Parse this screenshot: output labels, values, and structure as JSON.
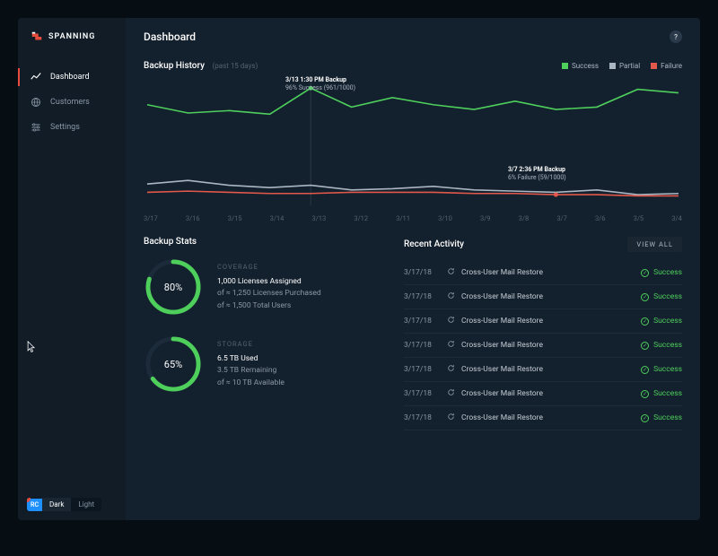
{
  "brand": {
    "name": "SPANNING"
  },
  "page_title": "Dashboard",
  "sidebar": {
    "items": [
      {
        "label": "Dashboard",
        "icon": "chart-line-icon",
        "active": true
      },
      {
        "label": "Customers",
        "icon": "globe-icon",
        "active": false
      },
      {
        "label": "Settings",
        "icon": "sliders-icon",
        "active": false
      }
    ]
  },
  "theme": {
    "badge": "RC",
    "badge_count": "1",
    "options": [
      {
        "label": "Dark",
        "active": true
      },
      {
        "label": "Light",
        "active": false
      }
    ]
  },
  "history": {
    "title": "Backup History",
    "subtitle": "(past 15 days)",
    "legend": [
      {
        "label": "Success",
        "color": "#4ecf5c"
      },
      {
        "label": "Partial",
        "color": "#aab6c2"
      },
      {
        "label": "Failure",
        "color": "#e2584a"
      }
    ],
    "x_labels": [
      "3/17",
      "3/16",
      "3/15",
      "3/14",
      "3/13",
      "3/12",
      "3/11",
      "3/10",
      "3/9",
      "3/8",
      "3/7",
      "3/6",
      "3/5",
      "3/4"
    ],
    "tooltip_success": {
      "line1": "3/13 1:30 PM Backup",
      "line2": "96% Success (961/1000)"
    },
    "tooltip_failure": {
      "line1": "3/7 2:36 PM Backup",
      "line2": "6% Failure (59/1000)"
    }
  },
  "chart_data": {
    "type": "line",
    "xlabel": "",
    "ylabel": "",
    "ylim": [
      0,
      100
    ],
    "categories": [
      "3/17",
      "3/16",
      "3/15",
      "3/14",
      "3/13",
      "3/12",
      "3/11",
      "3/10",
      "3/9",
      "3/8",
      "3/7",
      "3/6",
      "3/5",
      "3/4"
    ],
    "series": [
      {
        "name": "Success",
        "color": "#4ecf5c",
        "values": [
          82,
          75,
          77,
          74,
          96,
          80,
          88,
          82,
          78,
          85,
          78,
          80,
          95,
          92
        ]
      },
      {
        "name": "Partial",
        "color": "#aab6c2",
        "values": [
          15,
          18,
          14,
          12,
          14,
          10,
          11,
          13,
          10,
          9,
          8,
          10,
          6,
          7
        ]
      },
      {
        "name": "Failure",
        "color": "#e2584a",
        "values": [
          8,
          9,
          8,
          7,
          7,
          8,
          8,
          8,
          7,
          7,
          6,
          6,
          5,
          5
        ]
      }
    ],
    "annotations": [
      {
        "x": "3/13",
        "series": "Success",
        "text": "3/13 1:30 PM Backup — 96% Success (961/1000)"
      },
      {
        "x": "3/7",
        "series": "Failure",
        "text": "3/7 2:36 PM Backup — 6% Failure (59/1000)"
      }
    ]
  },
  "stats": {
    "title": "Backup Stats",
    "coverage": {
      "label": "COVERAGE",
      "pct": "80%",
      "pct_num": 80,
      "line1": "1,000 Licenses Assigned",
      "line2": "of ≈ 1,250 Licenses Purchased",
      "line3": "of ≈ 1,500 Total Users"
    },
    "storage": {
      "label": "STORAGE",
      "pct": "65%",
      "pct_num": 65,
      "line1": "6.5 TB Used",
      "line2": "3.5 TB Remaining",
      "line3": "of ≈ 10 TB Available"
    }
  },
  "activity": {
    "title": "Recent Activity",
    "view_all": "VIEW ALL",
    "status_label": "Success",
    "rows": [
      {
        "date": "3/17/18",
        "name": "Cross-User Mail Restore",
        "status": "Success"
      },
      {
        "date": "3/17/18",
        "name": "Cross-User Mail Restore",
        "status": "Success"
      },
      {
        "date": "3/17/18",
        "name": "Cross-User Mail Restore",
        "status": "Success"
      },
      {
        "date": "3/17/18",
        "name": "Cross-User Mail Restore",
        "status": "Success"
      },
      {
        "date": "3/17/18",
        "name": "Cross-User Mail Restore",
        "status": "Success"
      },
      {
        "date": "3/17/18",
        "name": "Cross-User Mail Restore",
        "status": "Success"
      },
      {
        "date": "3/17/18",
        "name": "Cross-User Mail Restore",
        "status": "Success"
      }
    ]
  },
  "colors": {
    "success": "#4ecf5c",
    "partial": "#aab6c2",
    "failure": "#e2584a",
    "accent": "#e74c3c"
  }
}
